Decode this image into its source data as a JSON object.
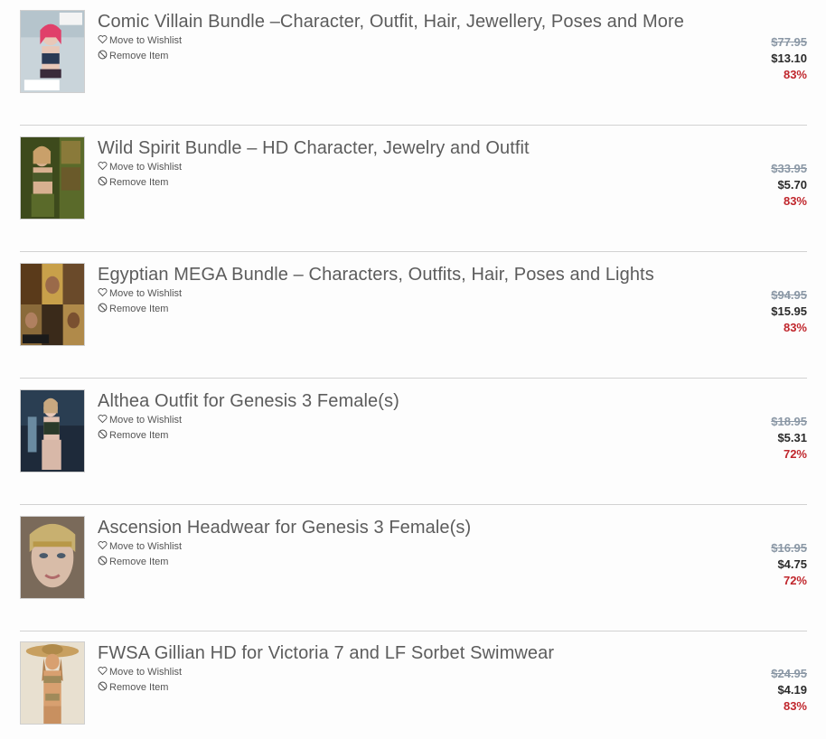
{
  "cart": {
    "items": [
      {
        "title": "Comic Villain Bundle –Character, Outfit, Hair, Jewellery, Poses and More",
        "wishlist_label": "Move to Wishlist",
        "remove_label": "Remove Item",
        "original_price": "$77.95",
        "sale_price": "$13.10",
        "discount": "83%",
        "thumbnail_colors": [
          "#c9d4da",
          "#e0406a",
          "#2a3a55"
        ]
      },
      {
        "title": "Wild Spirit Bundle – HD Character, Jewelry and Outfit",
        "wishlist_label": "Move to Wishlist",
        "remove_label": "Remove Item",
        "original_price": "$33.95",
        "sale_price": "$5.70",
        "discount": "83%",
        "thumbnail_colors": [
          "#3d4a1c",
          "#8a7a3a",
          "#c9a06a"
        ]
      },
      {
        "title": "Egyptian MEGA Bundle – Characters, Outfits, Hair, Poses and Lights",
        "wishlist_label": "Move to Wishlist",
        "remove_label": "Remove Item",
        "original_price": "$94.95",
        "sale_price": "$15.95",
        "discount": "83%",
        "thumbnail_colors": [
          "#5a3a1a",
          "#c8a04a",
          "#2a2418"
        ]
      },
      {
        "title": "Althea Outfit for Genesis 3 Female(s)",
        "wishlist_label": "Move to Wishlist",
        "remove_label": "Remove Item",
        "original_price": "$18.95",
        "sale_price": "$5.31",
        "discount": "72%",
        "thumbnail_colors": [
          "#1e2a3a",
          "#6a8aa0",
          "#d8b8a8"
        ]
      },
      {
        "title": "Ascension Headwear for Genesis 3 Female(s)",
        "wishlist_label": "Move to Wishlist",
        "remove_label": "Remove Item",
        "original_price": "$16.95",
        "sale_price": "$4.75",
        "discount": "72%",
        "thumbnail_colors": [
          "#7a6a5a",
          "#d8bca8",
          "#c8b070"
        ]
      },
      {
        "title": "FWSA Gillian HD for Victoria 7 and LF Sorbet Swimwear",
        "wishlist_label": "Move to Wishlist",
        "remove_label": "Remove Item",
        "original_price": "$24.95",
        "sale_price": "$4.19",
        "discount": "83%",
        "thumbnail_colors": [
          "#e8e0d0",
          "#b08050",
          "#d8a060"
        ]
      }
    ]
  }
}
